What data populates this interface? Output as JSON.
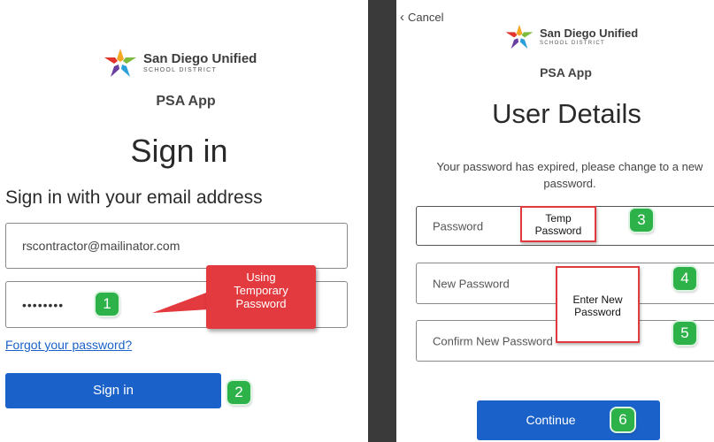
{
  "brand": {
    "name_line1": "San Diego Unified",
    "name_line2": "SCHOOL DISTRICT",
    "app_name": "PSA App"
  },
  "left_screen": {
    "title": "Sign in",
    "subtitle": "Sign in with your email address",
    "email_value": "rscontractor@mailinator.com",
    "password_value": "••••••••",
    "forgot_link": "Forgot your password?",
    "signin_button": "Sign in"
  },
  "right_screen": {
    "cancel_label": "Cancel",
    "title": "User Details",
    "message": "Your password has expired, please change to a new password.",
    "password_placeholder": "Password",
    "new_password_placeholder": "New Password",
    "confirm_password_placeholder": "Confirm New Password",
    "continue_button": "Continue"
  },
  "annotations": {
    "step1": "1",
    "step2": "2",
    "step3": "3",
    "step4": "4",
    "step5": "5",
    "step6": "6",
    "using_temp_line1": "Using",
    "using_temp_line2": "Temporary",
    "using_temp_line3": "Password",
    "temp_pw_line1": "Temp",
    "temp_pw_line2": "Password",
    "enter_new_line1": "Enter New",
    "enter_new_line2": "Password"
  },
  "colors": {
    "primary_button": "#1a62c9",
    "link": "#1a62c9",
    "step_badge": "#2db24a",
    "callout_red": "#e33a3f",
    "divider": "#3a3a3a"
  }
}
